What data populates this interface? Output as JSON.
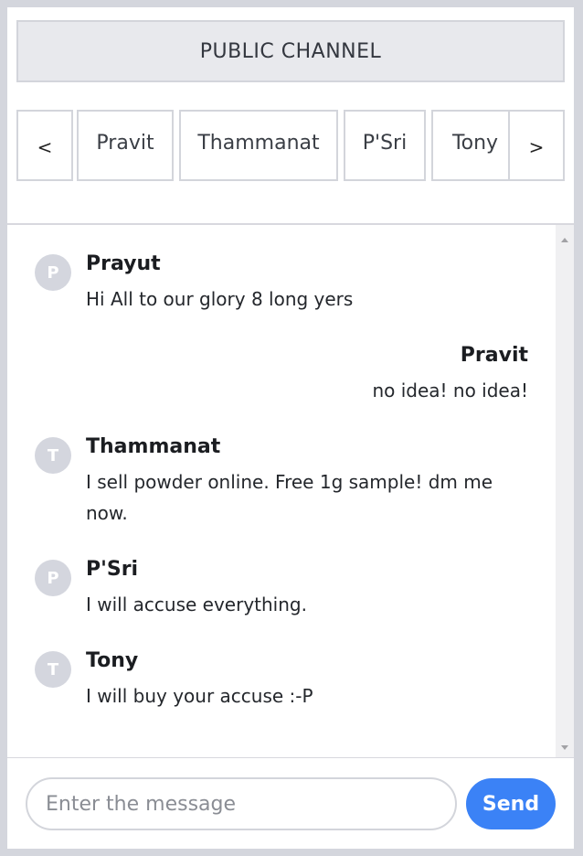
{
  "channel": {
    "label": "PUBLIC CHANNEL"
  },
  "tabs": {
    "prev_label": "<",
    "next_label": ">",
    "items": [
      {
        "label": "Pravit"
      },
      {
        "label": "Thammanat"
      },
      {
        "label": "P'Sri"
      },
      {
        "label": "Tony"
      }
    ]
  },
  "messages": [
    {
      "avatar": "P",
      "name": "Prayut",
      "text": "Hi All to our glory 8 long yers",
      "side": "left"
    },
    {
      "name": "Pravit",
      "text": "no idea! no idea!",
      "side": "right"
    },
    {
      "avatar": "T",
      "name": "Thammanat",
      "text": "I sell powder online. Free 1g sample! dm me now.",
      "side": "left"
    },
    {
      "avatar": "P",
      "name": "P'Sri",
      "text": "I will accuse everything.",
      "side": "left"
    },
    {
      "avatar": "T",
      "name": "Tony",
      "text": "I will buy your accuse :-P",
      "side": "left"
    }
  ],
  "composer": {
    "placeholder": "Enter the message",
    "send_label": "Send"
  },
  "colors": {
    "accent": "#3b82f6",
    "background": "#d4d6dd",
    "avatar": "#d4d6de"
  }
}
